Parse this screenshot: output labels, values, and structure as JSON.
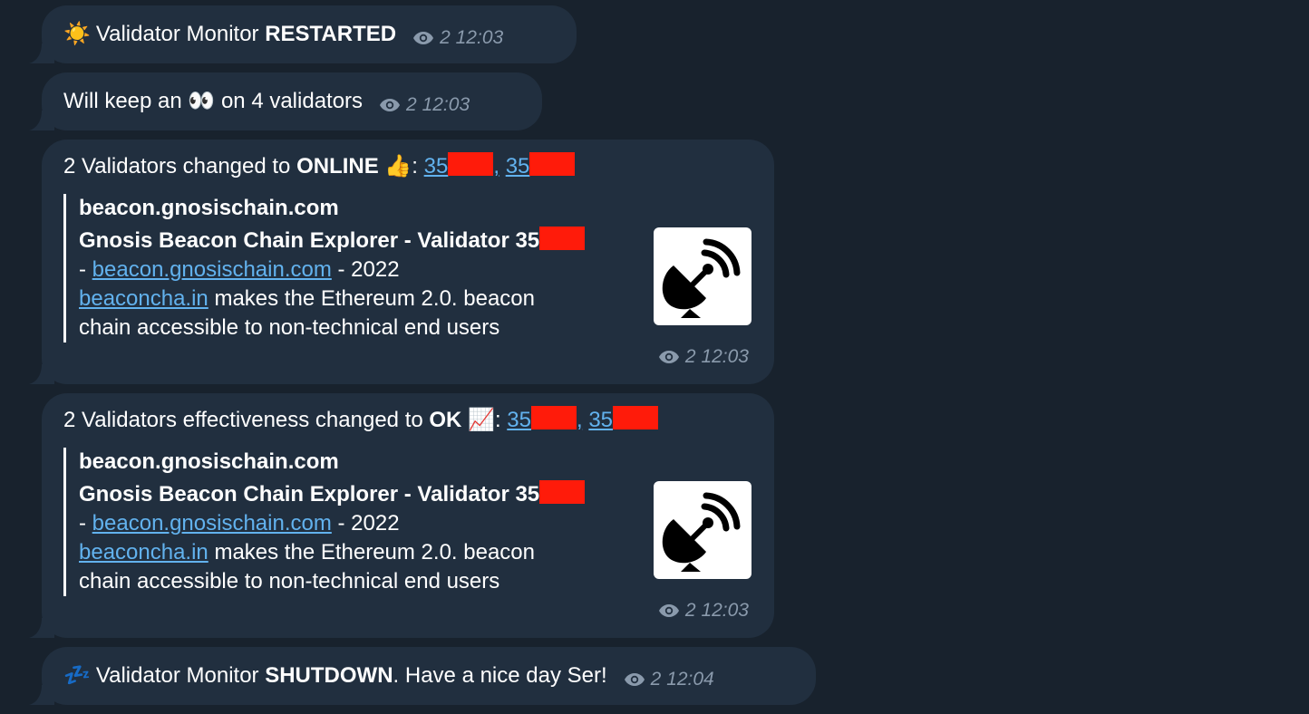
{
  "messages": {
    "m1": {
      "emoji": "☀️",
      "text_prefix": "Validator Monitor ",
      "text_bold": "RESTARTED",
      "views": "2",
      "time": "12:03"
    },
    "m2": {
      "text_prefix": "Will keep an ",
      "emoji": "👀",
      "text_suffix": " on 4 validators",
      "views": "2",
      "time": "12:03"
    },
    "m3": {
      "text_prefix": "2 Validators changed to ",
      "text_bold": "ONLINE",
      "emoji": "👍",
      "colon": ":",
      "link1": "35",
      "separator": ",",
      "link2": "35",
      "preview": {
        "site": "beacon.gnosischain.com",
        "title": "Gnosis Beacon Chain Explorer - Validator 35",
        "desc_dash": "- ",
        "desc_link1": "beacon.gnosischain.com",
        "desc_year": " - 2022",
        "desc_link2": "beaconcha.in",
        "desc_rest1": " makes the Ethereum 2.0. beacon",
        "desc_rest2": "chain accessible to non-technical end users",
        "thumb_icon": "satellite-dish-icon"
      },
      "views": "2",
      "time": "12:03"
    },
    "m4": {
      "text_prefix": "2 Validators effectiveness changed to ",
      "text_bold": "OK",
      "emoji": "📈",
      "colon": ":",
      "link1": "35",
      "separator": ",",
      "link2": "35",
      "preview": {
        "site": "beacon.gnosischain.com",
        "title": "Gnosis Beacon Chain Explorer - Validator 35",
        "desc_dash": "- ",
        "desc_link1": "beacon.gnosischain.com",
        "desc_year": " - 2022",
        "desc_link2": "beaconcha.in",
        "desc_rest1": " makes the Ethereum 2.0. beacon",
        "desc_rest2": "chain accessible to non-technical end users",
        "thumb_icon": "satellite-dish-icon"
      },
      "views": "2",
      "time": "12:03"
    },
    "m5": {
      "emoji": "💤",
      "text_prefix": "Validator Monitor ",
      "text_bold": "SHUTDOWN",
      "text_suffix": ". Have a nice day Ser!",
      "views": "2",
      "time": "12:04"
    }
  },
  "colors": {
    "background": "#18222d",
    "bubble": "#212f3f",
    "link": "#62b2ee",
    "meta": "#8a9aac",
    "redaction": "#ff1b0a"
  }
}
